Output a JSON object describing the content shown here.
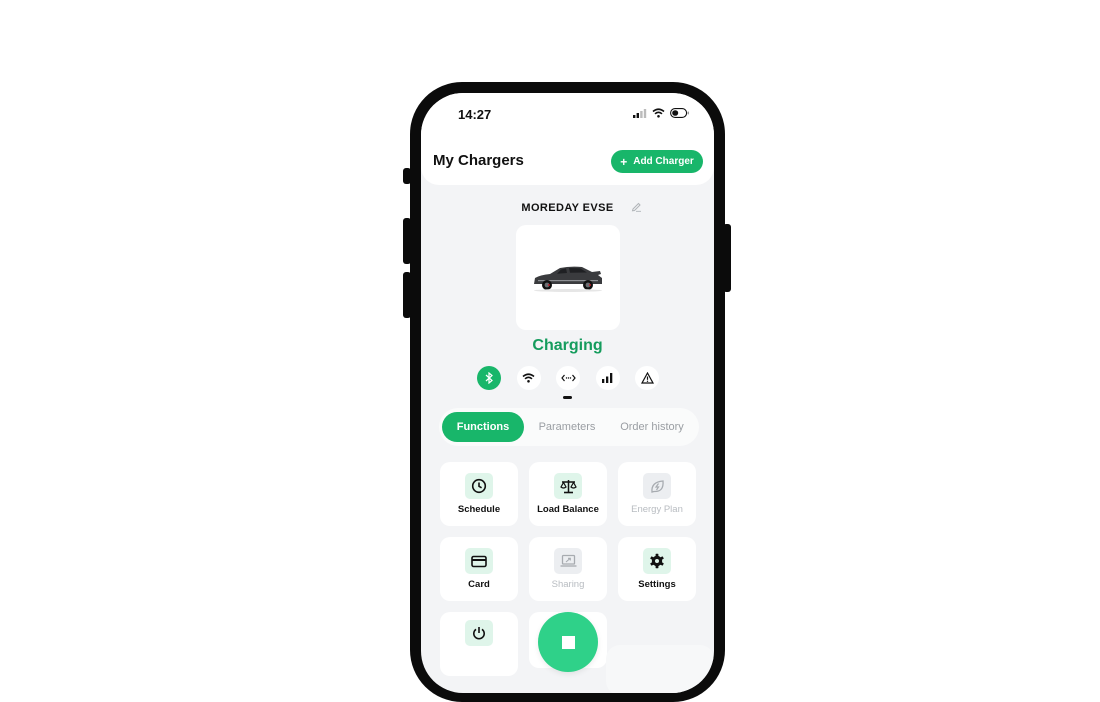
{
  "status_bar": {
    "time": "14:27"
  },
  "header": {
    "title": "My Chargers",
    "add_button_icon": "+",
    "add_button_label": "Add Charger"
  },
  "charger": {
    "name": "MOREDAY EVSE",
    "status": "Charging",
    "connections": [
      {
        "icon": "bluetooth-icon",
        "active": true
      },
      {
        "icon": "wifi-icon",
        "active": false
      },
      {
        "icon": "ethernet-icon",
        "active": false
      },
      {
        "icon": "cellular-signal-icon",
        "active": false
      },
      {
        "icon": "warning-icon",
        "active": false
      }
    ]
  },
  "tabs": [
    {
      "label": "Functions",
      "active": true
    },
    {
      "label": "Parameters",
      "active": false
    },
    {
      "label": "Order history",
      "active": false
    }
  ],
  "functions": [
    {
      "label": "Schedule",
      "icon": "clock-icon",
      "enabled": true
    },
    {
      "label": "Load Balance",
      "icon": "scale-icon",
      "enabled": true
    },
    {
      "label": "Energy Plan",
      "icon": "energy-leaf-icon",
      "enabled": false
    },
    {
      "label": "Card",
      "icon": "card-icon",
      "enabled": true
    },
    {
      "label": "Sharing",
      "icon": "share-screen-icon",
      "enabled": false
    },
    {
      "label": "Settings",
      "icon": "gear-icon",
      "enabled": true
    },
    {
      "label": "",
      "icon": "power-icon",
      "enabled": true
    }
  ],
  "colors": {
    "accent": "#18b66a",
    "status_text": "#159c5d",
    "stop_button": "#2fd189"
  }
}
